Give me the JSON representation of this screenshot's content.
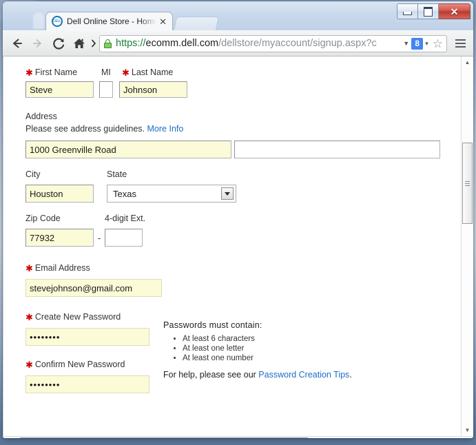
{
  "window": {
    "minimize_label": "Minimize",
    "maximize_label": "Maximize",
    "close_label": "✕"
  },
  "tab": {
    "title": "Dell Online Store - Home",
    "close_label": "✕",
    "favicon_text": "DELL"
  },
  "toolbar": {
    "back_label": "Back",
    "forward_label": "Forward",
    "reload_label": "Reload",
    "home_label": "Home",
    "chevron_label": "›",
    "url_scheme": "https://",
    "url_host": "ecomm.dell.com",
    "url_path": "/dellstore/myaccount/signup.aspx?c",
    "dropdown_caret": "▼",
    "gplus_label": "8",
    "gplus_caret": "▾",
    "star_label": "☆",
    "menu_label": "Menu"
  },
  "form": {
    "first_name": {
      "label": "First Name",
      "value": "Steve",
      "required": true
    },
    "mi": {
      "label": "MI",
      "value": "",
      "required": false
    },
    "last_name": {
      "label": "Last Name",
      "value": "Johnson",
      "required": true
    },
    "address": {
      "label": "Address",
      "helper_text": "Please see address guidelines.",
      "more_info_link": "More Info",
      "line1_value": "1000 Greenville Road",
      "line2_value": ""
    },
    "city": {
      "label": "City",
      "value": "Houston"
    },
    "state": {
      "label": "State",
      "value": "Texas"
    },
    "zip": {
      "label": "Zip Code",
      "value": "77932"
    },
    "ext": {
      "label": "4-digit Ext.",
      "value": "",
      "separator": "-"
    },
    "email": {
      "label": "Email Address",
      "value": "stevejohnson@gmail.com",
      "required": true
    },
    "create_password": {
      "label": "Create New Password",
      "value": "••••••••",
      "required": true
    },
    "confirm_password": {
      "label": "Confirm New Password",
      "value": "••••••••",
      "required": true
    },
    "required_marker": "✱"
  },
  "password_rules": {
    "title": "Passwords must contain:",
    "items": [
      "At least 6 characters",
      "At least one letter",
      "At least one number"
    ],
    "help_prefix": "For help, please see our",
    "help_link": "Password Creation Tips",
    "help_suffix": "."
  },
  "scrollbars": {
    "up_arrow": "▲",
    "down_arrow": "▼",
    "left_arrow": "◀",
    "right_arrow": "▶"
  }
}
